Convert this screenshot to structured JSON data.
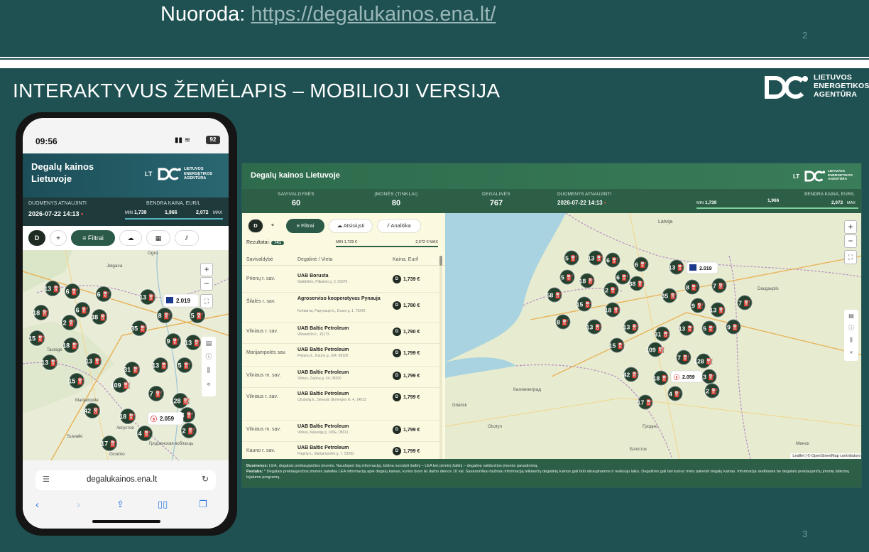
{
  "top_slide": {
    "label": "Nuoroda:",
    "link": "https://degalukainos.ena.lt/",
    "page_number": "2"
  },
  "main_slide": {
    "title": "INTERAKTYVUS ŽEMĖLAPIS – MOBILIOJI VERSIJA",
    "brand_lines": [
      "LIETUVOS",
      "ENERGETIKOS",
      "AGENTŪRA"
    ],
    "page_number": "3"
  },
  "phone": {
    "time": "09:56",
    "battery": "92",
    "app_title": "Degalų kainos Lietuvoje",
    "lang": "LT",
    "logo_lines": [
      "LIETUVOS",
      "ENERGETIKOS",
      "AGENTŪRA"
    ],
    "updated_label": "DUOMENYS ATNAUJINTI",
    "updated_value": "2026-07-22 14:13",
    "price_label": "BENDRA KAINA, EUR/L",
    "min_label": "MIN",
    "min_value": "1,739",
    "mid_value": "1,966",
    "max_value": "2,072",
    "max_label": "MAX",
    "fuel_type": "D",
    "filter_label": "Filtrai",
    "url": "degalukainos.ena.lt",
    "highlight_price": "2.019",
    "highlight_price2": "2.059",
    "map_places": [
      "Jelgava",
      "Ogre",
      "Tauragė",
      "Marijampolė",
      "Suwałki",
      "Grodno",
      "Гродзенская вобласць",
      "Августов"
    ]
  },
  "desktop": {
    "app_title": "Degalų kainos Lietuvoje",
    "lang": "LT",
    "stats": [
      {
        "label": "SAVIVALDYBĖS",
        "value": "60"
      },
      {
        "label": "ĮMONĖS (TINKLAI)",
        "value": "80"
      },
      {
        "label": "DEGALINĖS",
        "value": "767"
      }
    ],
    "updated_label": "DUOMENYS ATNAUJINTI",
    "updated_value": "2026-07-22 14:13",
    "price_label": "BENDRA KAINA, EUR/L",
    "min_label": "MIN",
    "min_value": "1,739",
    "mid_value": "1,966",
    "max_value": "2,072",
    "max_label": "MAX",
    "fuel_type": "D",
    "buttons": {
      "filters": "Filtrai",
      "download": "Atsisiųsti",
      "analytics": "Analitika"
    },
    "results_label": "Rezultatai:",
    "results_count": "741",
    "range_min": "MIN 1,739 €",
    "range_max": "2,072 € MAX",
    "columns": [
      "Savivaldybė",
      "Degalinė / Vieta",
      "Kaina, Eur/l"
    ],
    "rows": [
      {
        "muni": "Prienų r. sav.",
        "name": "UAB Borusta",
        "addr": "Stakliškės, Pilkalnio g. 3, 59370",
        "price": "1,739 €"
      },
      {
        "muni": "Šilalės r. sav.",
        "name": "Agroserviso kooperatyvas Pynauja",
        "addr": "Kvėdarna, Papynaujo k., Dvaro g. 1, 75342",
        "price": "1,780 €"
      },
      {
        "muni": "Vilniaus r. sav.",
        "name": "UAB Baltic Petroleum",
        "addr": "Vilkaraičio k., 15173",
        "price": "1,790 €"
      },
      {
        "muni": "Marijampolės sav.",
        "name": "UAB Baltic Petroleum",
        "addr": "Pietarių k., Kauno g. 164, 68100",
        "price": "1,799 €"
      },
      {
        "muni": "Vilniaus m. sav.",
        "name": "UAB Baltic Petroleum",
        "addr": "Vilnius, Zujūnų g. 24, 08200",
        "price": "1,799 €"
      },
      {
        "muni": "Vilniaus r. sav.",
        "name": "UAB Baltic Petroleum",
        "addr": "Užubalių k., Senasis Ukmergės kl. 4, 14013",
        "price": "1,799 €"
      },
      {
        "muni": "Vilniaus m. sav.",
        "name": "UAB Baltic Petroleum",
        "addr": "Vilnius, Kalvarijų g. 165E, 08311",
        "price": "1,799 €"
      },
      {
        "muni": "Kauno r. sav.",
        "name": "UAB Baltic Petroleum",
        "addr": "Pagirių k., Marijampolės g. 7, 53282",
        "price": "1,799 €"
      }
    ],
    "highlight_price": "2.019",
    "highlight_price2": "2.059",
    "map_places": [
      "Latvija",
      "Daugavpils",
      "Минск",
      "Гродно",
      "Калининград",
      "Gdańsk",
      "Olsztyn",
      "Білосток"
    ],
    "attribution": "Leaflet | © OpenStreetMap contributors",
    "footer_sources_label": "Duomenys:",
    "footer_sources": "LEA, degalais prekiaujančios įmonės. Naudojant šią informaciją, būtina nurodyti šaltinį – LEA bei pirminį šaltinį – degalinę valdančios įmonės pavadinimą.",
    "footer_note_label": "Pastaba:",
    "footer_note": "* Degalais prekiaujančios įmonės pateikia LEA informaciją apie degalų kainas, kurios buvo iki darbo dienos 10 val. Savanoriškai dažniau informaciją teikiančių degalinių kainos gali būti atnaujinamos ir realiuoju laiku. Degalinės gali bet kuriuo metu pakeisti degalų kainas. Informacija skelbiama be degalais prekiaujančių įmonių talkomų lojalumo programų."
  },
  "colors": {
    "slide_bg": "#1f5152",
    "app_green": "#2c5f46",
    "cluster": "#24402f",
    "accent_red": "#d4262b"
  }
}
